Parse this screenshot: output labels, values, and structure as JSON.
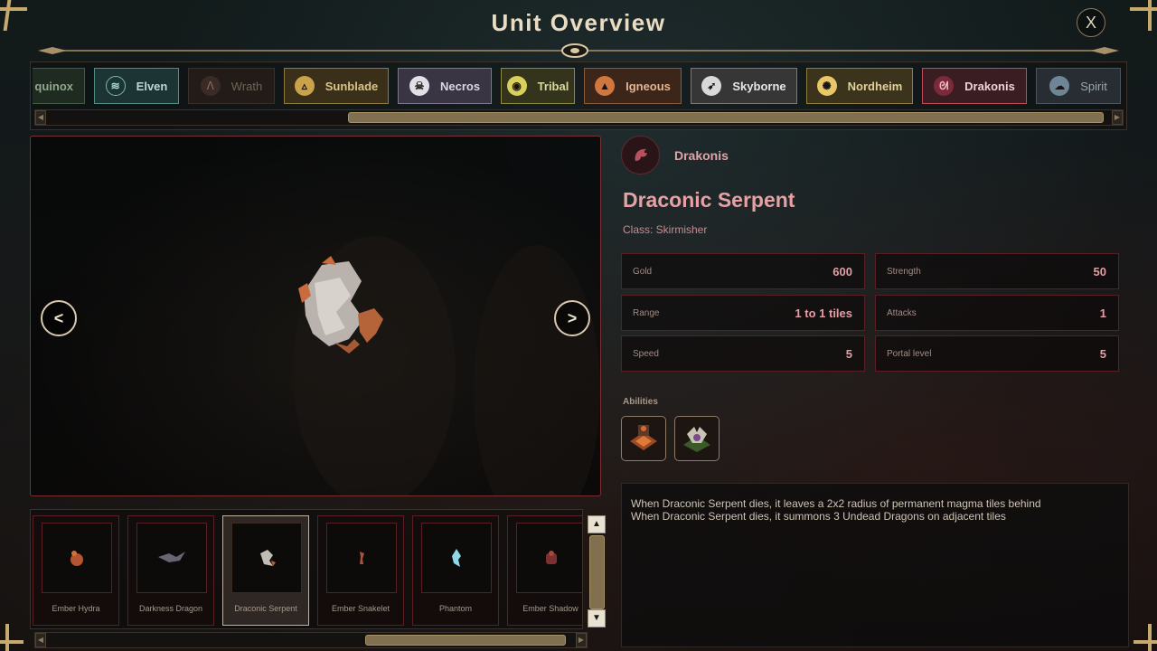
{
  "window": {
    "title": "Unit Overview",
    "close_label": "X"
  },
  "factions": [
    {
      "label": "quinox",
      "icon": "equinox-icon",
      "state": "default"
    },
    {
      "label": "Elven",
      "icon": "leaf-icon",
      "state": "default"
    },
    {
      "label": "Wrath",
      "icon": "claw-icon",
      "state": "dimmed"
    },
    {
      "label": "Sunblade",
      "icon": "triangle-icon",
      "state": "default"
    },
    {
      "label": "Necros",
      "icon": "skull-icon",
      "state": "default"
    },
    {
      "label": "Tribal",
      "icon": "mask-icon",
      "state": "default"
    },
    {
      "label": "Igneous",
      "icon": "flame-icon",
      "state": "default"
    },
    {
      "label": "Skyborne",
      "icon": "bird-icon",
      "state": "default"
    },
    {
      "label": "Nordheim",
      "icon": "sun-icon",
      "state": "default"
    },
    {
      "label": "Drakonis",
      "icon": "dragon-icon",
      "state": "selected"
    },
    {
      "label": "Spirit",
      "icon": "ghost-icon",
      "state": "dimmed"
    }
  ],
  "faction_scroll": {
    "position": 0.52
  },
  "preview": {
    "prev_label": "<",
    "next_label": ">"
  },
  "units": [
    {
      "name": "Ember Hydra",
      "selected": false
    },
    {
      "name": "Darkness Dragon",
      "selected": false
    },
    {
      "name": "Draconic Serpent",
      "selected": true
    },
    {
      "name": "Ember Snakelet",
      "selected": false
    },
    {
      "name": "Phantom",
      "selected": false
    },
    {
      "name": "Ember Shadow",
      "selected": false
    }
  ],
  "unit_scroll": {
    "up_label": "▲",
    "down_label": "▼"
  },
  "detail": {
    "faction": "Drakonis",
    "unit_name": "Draconic Serpent",
    "unit_class": "Class: Skirmisher",
    "stats": [
      {
        "label": "Gold",
        "value": "600"
      },
      {
        "label": "Strength",
        "value": "50"
      },
      {
        "label": "Range",
        "value": "1 to 1 tiles"
      },
      {
        "label": "Attacks",
        "value": "1"
      },
      {
        "label": "Speed",
        "value": "5"
      },
      {
        "label": "Portal level",
        "value": "5"
      }
    ],
    "abilities_label": "Abilities",
    "abilities": [
      {
        "icon": "magma-tile-icon"
      },
      {
        "icon": "undead-dragon-icon"
      }
    ],
    "description": [
      "When Draconic Serpent dies, it leaves a 2x2 radius of permanent magma tiles behind",
      "When Draconic Serpent dies, it summons 3 Undead Dragons on adjacent tiles"
    ]
  },
  "colors": {
    "accent_gold": "#c6a96c",
    "drakonis_red": "#c24b59",
    "stat_value": "#e39fa5"
  }
}
